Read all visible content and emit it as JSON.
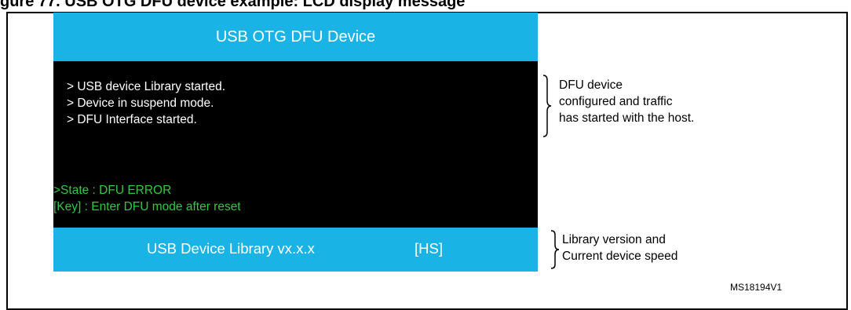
{
  "figure_caption": "gure 77. USB OTG DFU device example: LCD display message",
  "header": {
    "title": "USB OTG DFU Device"
  },
  "screen": {
    "log": [
      "> USB device Library started.",
      "> Device in suspend mode.",
      "> DFU Interface started."
    ],
    "status": [
      ">State : DFU ERROR",
      "[Key] : Enter DFU mode after reset"
    ]
  },
  "footer": {
    "library": "USB Device Library vx.x.x",
    "speed": "[HS]"
  },
  "annotations": {
    "dfu_lines": [
      "DFU device",
      "configured and traffic",
      "has started with the host."
    ],
    "library_lines": [
      "Library version and",
      "Current device speed"
    ]
  },
  "figure_code": "MS18194V1",
  "colors": {
    "header_bg": "#1ab3e6",
    "screen_bg": "#000000",
    "log_text": "#ffffff",
    "status_text": "#2ecc40"
  }
}
